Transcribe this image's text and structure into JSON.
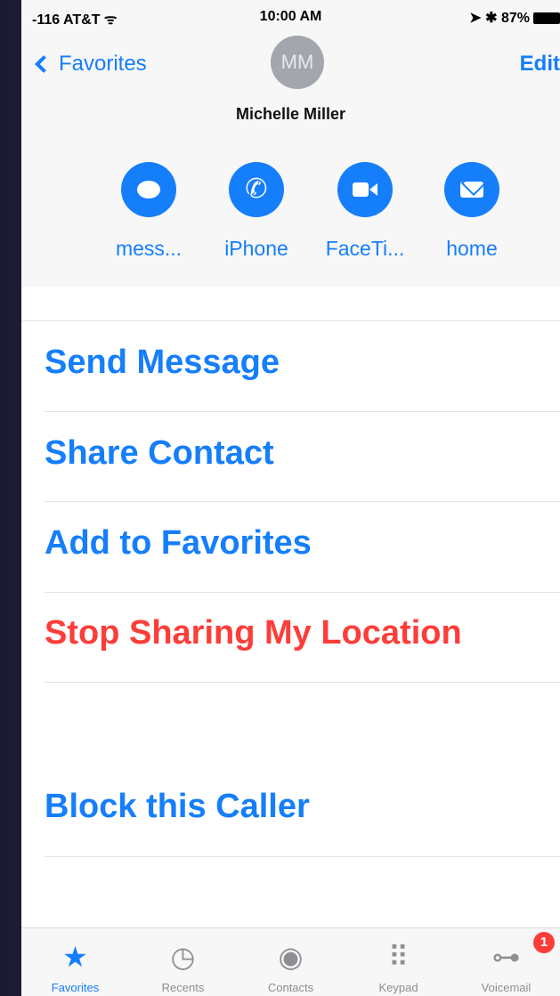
{
  "status_bar": {
    "carrier": "-116 AT&T ᯤ",
    "time": "10:00 AM",
    "right": "➤ ✱ 87%"
  },
  "nav": {
    "back_label": "Favorites",
    "edit_label": "Edit"
  },
  "contact": {
    "initials": "MM",
    "name": "Michelle Miller"
  },
  "actions": [
    {
      "label": "mess...",
      "icon": "message-icon"
    },
    {
      "label": "iPhone",
      "icon": "phone-icon"
    },
    {
      "label": "FaceTi...",
      "icon": "video-icon"
    },
    {
      "label": "home",
      "icon": "mail-icon"
    }
  ],
  "menu": {
    "send_message": "Send Message",
    "share_contact": "Share Contact",
    "add_to_favorites": "Add to Favorites",
    "stop_sharing": "Stop Sharing My Location",
    "block_caller": "Block this Caller"
  },
  "tabs": [
    {
      "label": "Favorites",
      "icon": "star-icon",
      "active": true
    },
    {
      "label": "Recents",
      "icon": "clock-icon",
      "active": false
    },
    {
      "label": "Contacts",
      "icon": "contact-icon",
      "active": false
    },
    {
      "label": "Keypad",
      "icon": "keypad-icon",
      "active": false
    },
    {
      "label": "Voicemail",
      "icon": "voicemail-icon",
      "active": false,
      "badge": "1"
    }
  ],
  "colors": {
    "accent": "#157efb",
    "destructive": "#fc3d39",
    "header_bg": "#f7f7f7"
  }
}
